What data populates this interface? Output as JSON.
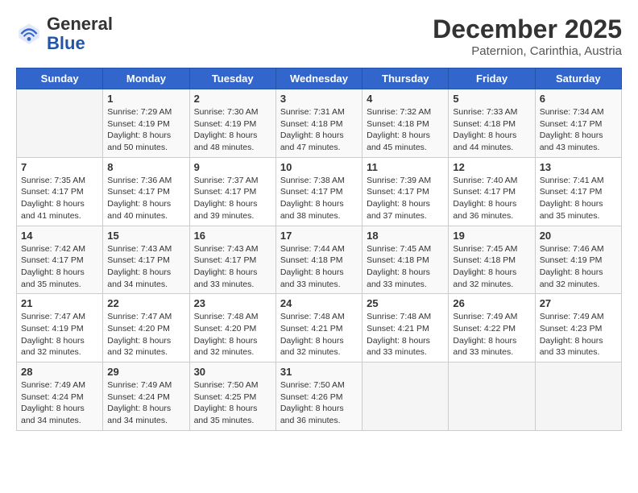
{
  "header": {
    "logo_general": "General",
    "logo_blue": "Blue",
    "month_title": "December 2025",
    "subtitle": "Paternion, Carinthia, Austria"
  },
  "days_of_week": [
    "Sunday",
    "Monday",
    "Tuesday",
    "Wednesday",
    "Thursday",
    "Friday",
    "Saturday"
  ],
  "weeks": [
    [
      {
        "day": "",
        "info": ""
      },
      {
        "day": "1",
        "info": "Sunrise: 7:29 AM\nSunset: 4:19 PM\nDaylight: 8 hours\nand 50 minutes."
      },
      {
        "day": "2",
        "info": "Sunrise: 7:30 AM\nSunset: 4:19 PM\nDaylight: 8 hours\nand 48 minutes."
      },
      {
        "day": "3",
        "info": "Sunrise: 7:31 AM\nSunset: 4:18 PM\nDaylight: 8 hours\nand 47 minutes."
      },
      {
        "day": "4",
        "info": "Sunrise: 7:32 AM\nSunset: 4:18 PM\nDaylight: 8 hours\nand 45 minutes."
      },
      {
        "day": "5",
        "info": "Sunrise: 7:33 AM\nSunset: 4:18 PM\nDaylight: 8 hours\nand 44 minutes."
      },
      {
        "day": "6",
        "info": "Sunrise: 7:34 AM\nSunset: 4:17 PM\nDaylight: 8 hours\nand 43 minutes."
      }
    ],
    [
      {
        "day": "7",
        "info": "Sunrise: 7:35 AM\nSunset: 4:17 PM\nDaylight: 8 hours\nand 41 minutes."
      },
      {
        "day": "8",
        "info": "Sunrise: 7:36 AM\nSunset: 4:17 PM\nDaylight: 8 hours\nand 40 minutes."
      },
      {
        "day": "9",
        "info": "Sunrise: 7:37 AM\nSunset: 4:17 PM\nDaylight: 8 hours\nand 39 minutes."
      },
      {
        "day": "10",
        "info": "Sunrise: 7:38 AM\nSunset: 4:17 PM\nDaylight: 8 hours\nand 38 minutes."
      },
      {
        "day": "11",
        "info": "Sunrise: 7:39 AM\nSunset: 4:17 PM\nDaylight: 8 hours\nand 37 minutes."
      },
      {
        "day": "12",
        "info": "Sunrise: 7:40 AM\nSunset: 4:17 PM\nDaylight: 8 hours\nand 36 minutes."
      },
      {
        "day": "13",
        "info": "Sunrise: 7:41 AM\nSunset: 4:17 PM\nDaylight: 8 hours\nand 35 minutes."
      }
    ],
    [
      {
        "day": "14",
        "info": "Sunrise: 7:42 AM\nSunset: 4:17 PM\nDaylight: 8 hours\nand 35 minutes."
      },
      {
        "day": "15",
        "info": "Sunrise: 7:43 AM\nSunset: 4:17 PM\nDaylight: 8 hours\nand 34 minutes."
      },
      {
        "day": "16",
        "info": "Sunrise: 7:43 AM\nSunset: 4:17 PM\nDaylight: 8 hours\nand 33 minutes."
      },
      {
        "day": "17",
        "info": "Sunrise: 7:44 AM\nSunset: 4:18 PM\nDaylight: 8 hours\nand 33 minutes."
      },
      {
        "day": "18",
        "info": "Sunrise: 7:45 AM\nSunset: 4:18 PM\nDaylight: 8 hours\nand 33 minutes."
      },
      {
        "day": "19",
        "info": "Sunrise: 7:45 AM\nSunset: 4:18 PM\nDaylight: 8 hours\nand 32 minutes."
      },
      {
        "day": "20",
        "info": "Sunrise: 7:46 AM\nSunset: 4:19 PM\nDaylight: 8 hours\nand 32 minutes."
      }
    ],
    [
      {
        "day": "21",
        "info": "Sunrise: 7:47 AM\nSunset: 4:19 PM\nDaylight: 8 hours\nand 32 minutes."
      },
      {
        "day": "22",
        "info": "Sunrise: 7:47 AM\nSunset: 4:20 PM\nDaylight: 8 hours\nand 32 minutes."
      },
      {
        "day": "23",
        "info": "Sunrise: 7:48 AM\nSunset: 4:20 PM\nDaylight: 8 hours\nand 32 minutes."
      },
      {
        "day": "24",
        "info": "Sunrise: 7:48 AM\nSunset: 4:21 PM\nDaylight: 8 hours\nand 32 minutes."
      },
      {
        "day": "25",
        "info": "Sunrise: 7:48 AM\nSunset: 4:21 PM\nDaylight: 8 hours\nand 33 minutes."
      },
      {
        "day": "26",
        "info": "Sunrise: 7:49 AM\nSunset: 4:22 PM\nDaylight: 8 hours\nand 33 minutes."
      },
      {
        "day": "27",
        "info": "Sunrise: 7:49 AM\nSunset: 4:23 PM\nDaylight: 8 hours\nand 33 minutes."
      }
    ],
    [
      {
        "day": "28",
        "info": "Sunrise: 7:49 AM\nSunset: 4:24 PM\nDaylight: 8 hours\nand 34 minutes."
      },
      {
        "day": "29",
        "info": "Sunrise: 7:49 AM\nSunset: 4:24 PM\nDaylight: 8 hours\nand 34 minutes."
      },
      {
        "day": "30",
        "info": "Sunrise: 7:50 AM\nSunset: 4:25 PM\nDaylight: 8 hours\nand 35 minutes."
      },
      {
        "day": "31",
        "info": "Sunrise: 7:50 AM\nSunset: 4:26 PM\nDaylight: 8 hours\nand 36 minutes."
      },
      {
        "day": "",
        "info": ""
      },
      {
        "day": "",
        "info": ""
      },
      {
        "day": "",
        "info": ""
      }
    ]
  ]
}
